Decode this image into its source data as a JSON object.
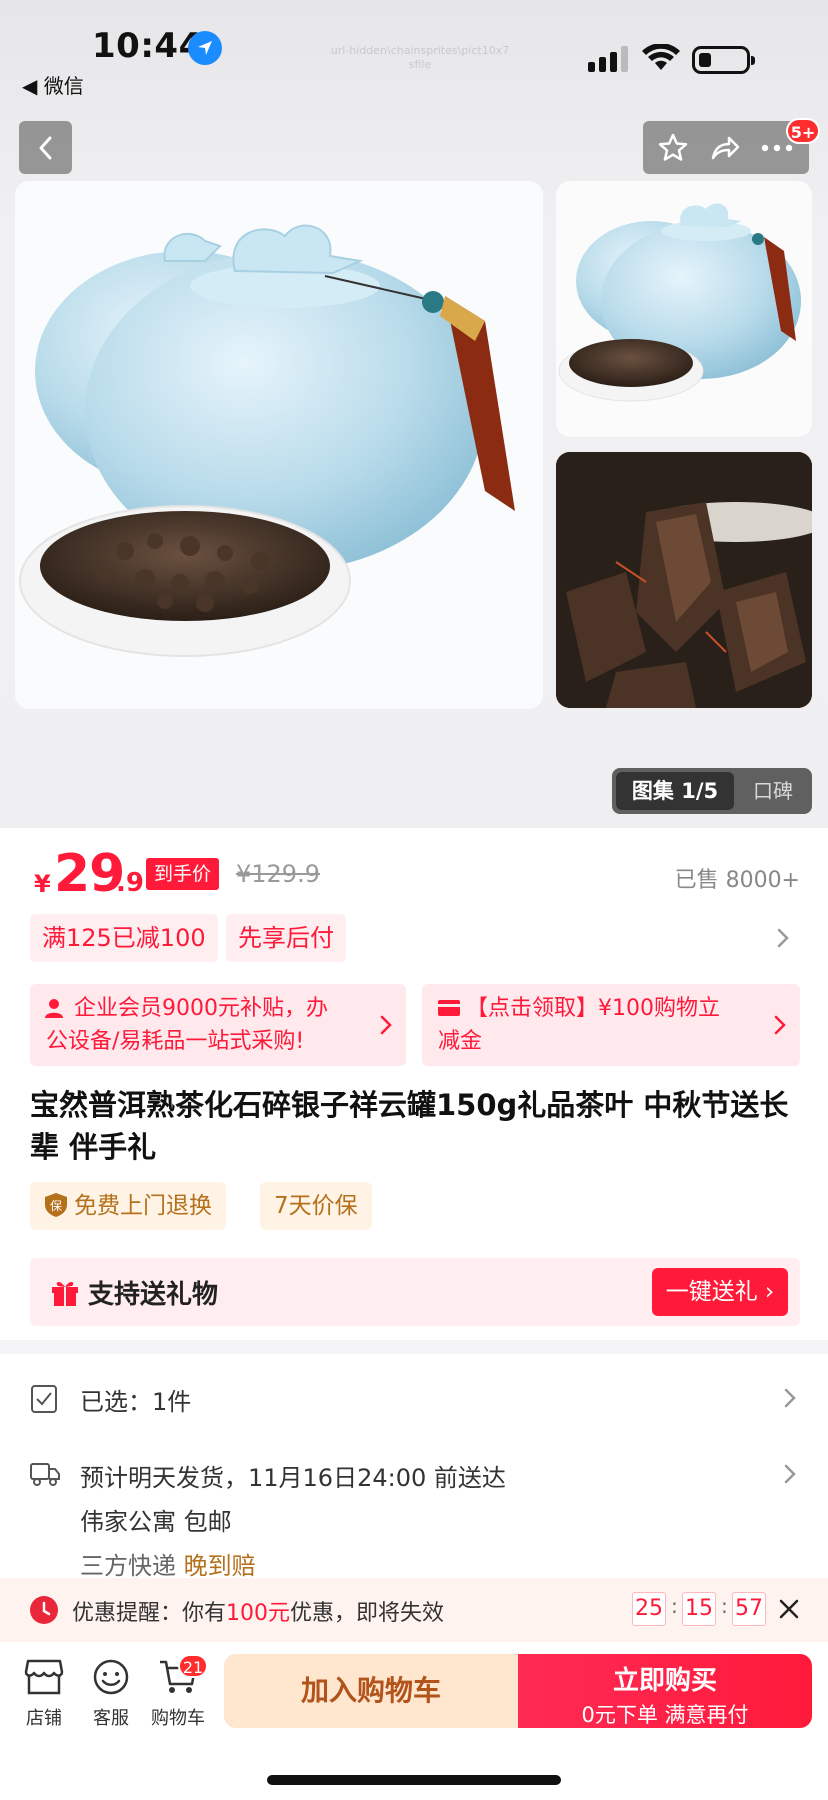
{
  "status_bar": {
    "time": "10:44",
    "back_app": "◀ 微信",
    "faint_url": "url-hidden\\chainsprites\\pict10x7\nsfile"
  },
  "nav": {
    "cart_badge": "5+"
  },
  "gallery": {
    "tab_active": "图集 1/5",
    "tab_other": "口碑"
  },
  "price": {
    "currency": "¥",
    "main": "29",
    "decimal": ".9",
    "final_tag": "到手价",
    "original": "¥129.9",
    "sold": "已售 8000+"
  },
  "promos": [
    "满125已减100",
    "先享后付"
  ],
  "cards": [
    {
      "line1": "企业会员9000元补贴，办",
      "line2": "公设备/易耗品一站式采购!"
    },
    {
      "line1": "【点击领取】¥100购物立",
      "line2": "减金"
    }
  ],
  "product_title": "宝然普洱熟茶化石碎银子祥云罐150g礼品茶叶 中秋节送长辈 伴手礼",
  "guarantees": [
    "免费上门退换",
    "7天价保"
  ],
  "gift": {
    "label": "支持送礼物",
    "button": "一键送礼"
  },
  "options": {
    "selected": "已选：1件",
    "shipping_line1": "预计明天发货，11月16日24:00 前送达",
    "shipping_line2": "伟家公寓   包邮",
    "shipping_line3_prefix": "三方快递",
    "shipping_line3_highlight": "晚到赔"
  },
  "reminder": {
    "prefix": "优惠提醒：你有",
    "amount": "100元",
    "suffix": "优惠，即将失效",
    "timer": [
      "25",
      "15",
      "57"
    ]
  },
  "bottom_bar": {
    "store": "店铺",
    "service": "客服",
    "cart": "购物车",
    "cart_badge": "21",
    "add_to_cart": "加入购物车",
    "buy_now": "立即购买",
    "buy_now_sub": "0元下单 满意再付"
  },
  "colors": {
    "accent": "#ff1a3a",
    "gold": "#b5701c"
  }
}
